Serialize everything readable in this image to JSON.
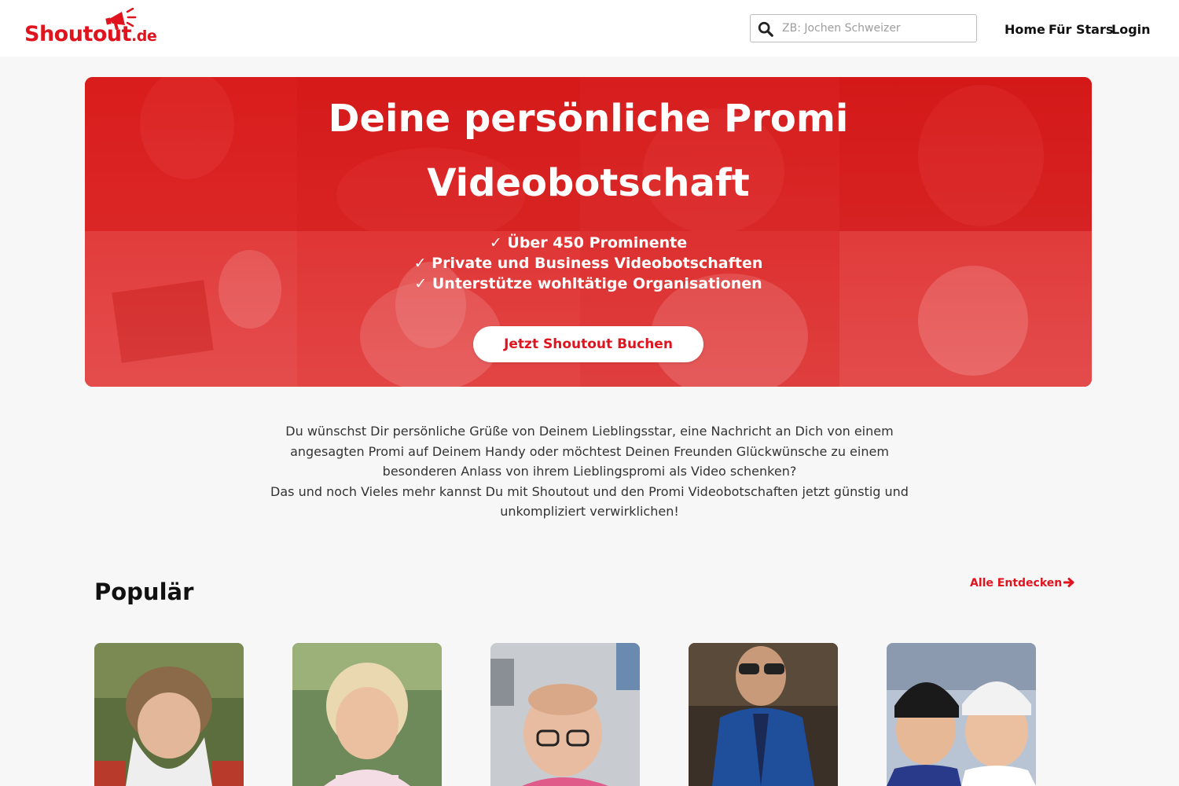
{
  "header": {
    "logo_text": "Shoutout",
    "logo_suffix": ".de",
    "search_placeholder": "ZB: Jochen Schweizer",
    "nav": {
      "home": "Home",
      "stars": "Für Stars",
      "login": "Login"
    }
  },
  "hero": {
    "title_line1": "Deine persönliche Promi",
    "title_line2": "Videobotschaft",
    "features": [
      "✓ Über 450 Prominente",
      "✓ Private und Business Videobotschaften",
      "✓ Unterstütze wohltätige Organisationen"
    ],
    "cta_label": "Jetzt Shoutout Buchen"
  },
  "intro": {
    "paragraph1": "Du wünschst Dir persönliche Grüße von Deinem Lieblingsstar, eine Nachricht an Dich von einem angesagten Promi auf Deinem Handy oder möchtest Deinen Freunden Glückwünsche zu einem besonderen Anlass von ihrem Lieblingspromi als Video schenken?",
    "paragraph2": "Das und noch Vieles mehr kannst Du mit Shoutout und den Promi Videobotschaften jetzt günstig und unkompliziert verwirklichen!"
  },
  "popular": {
    "title": "Populär",
    "all_link": "Alle Entdecken"
  },
  "colors": {
    "brand_red": "#e0141e",
    "header_bg": "#ffffff",
    "page_bg": "#f7f7f7"
  },
  "icons": {
    "search": "search-icon",
    "arrow": "arrow-right-icon",
    "logo": "megaphone-icon"
  }
}
